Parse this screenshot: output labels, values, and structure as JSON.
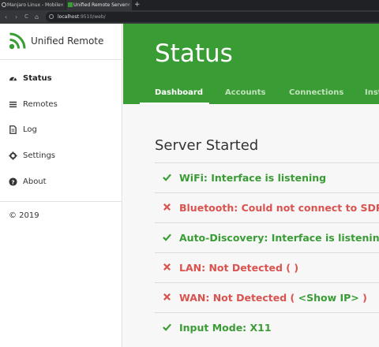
{
  "browser": {
    "tabs": [
      {
        "label": "Manjaro Linux - Mobile",
        "icon": "manjaro-icon",
        "close": "×"
      },
      {
        "label": "Unified Remote Server",
        "icon": "unified-remote-favicon",
        "close": "×"
      }
    ],
    "new_tab": "+",
    "nav": {
      "back": "‹",
      "forward": "›",
      "reload": "C"
    },
    "url_host": "localhost",
    "url_path": ":9510/web/"
  },
  "sidebar": {
    "brand": "Unified Remote",
    "items": [
      {
        "label": "Status",
        "icon": "dashboard-icon",
        "active": true
      },
      {
        "label": "Remotes",
        "icon": "list-icon"
      },
      {
        "label": "Log",
        "icon": "file-icon"
      },
      {
        "label": "Settings",
        "icon": "gear-icon"
      },
      {
        "label": "About",
        "icon": "question-icon"
      }
    ],
    "copyright": "© 2019"
  },
  "header": {
    "title": "Status",
    "tabs": [
      {
        "label": "Dashboard",
        "active": true
      },
      {
        "label": "Accounts"
      },
      {
        "label": "Connections"
      },
      {
        "label": "Inst"
      }
    ]
  },
  "main": {
    "server_title": "Server Started",
    "status_items": [
      {
        "state": "ok",
        "icon": "check-icon",
        "text": "WiFi: Interface is listening"
      },
      {
        "state": "error",
        "icon": "cross-icon",
        "text": "Bluetooth: Could not connect to SDP"
      },
      {
        "state": "ok",
        "icon": "check-icon",
        "text": "Auto-Discovery: Interface is listening"
      },
      {
        "state": "error",
        "icon": "cross-icon",
        "text": "LAN: Not Detected ( )"
      },
      {
        "state": "error",
        "icon": "cross-icon",
        "text_before": "WAN: Not Detected ( ",
        "link": "<Show IP>",
        "text_after": " )"
      },
      {
        "state": "ok",
        "icon": "check-icon",
        "text": "Input Mode: X11"
      }
    ]
  },
  "colors": {
    "accent_green": "#3a9c35",
    "error_red": "#d9534f"
  }
}
